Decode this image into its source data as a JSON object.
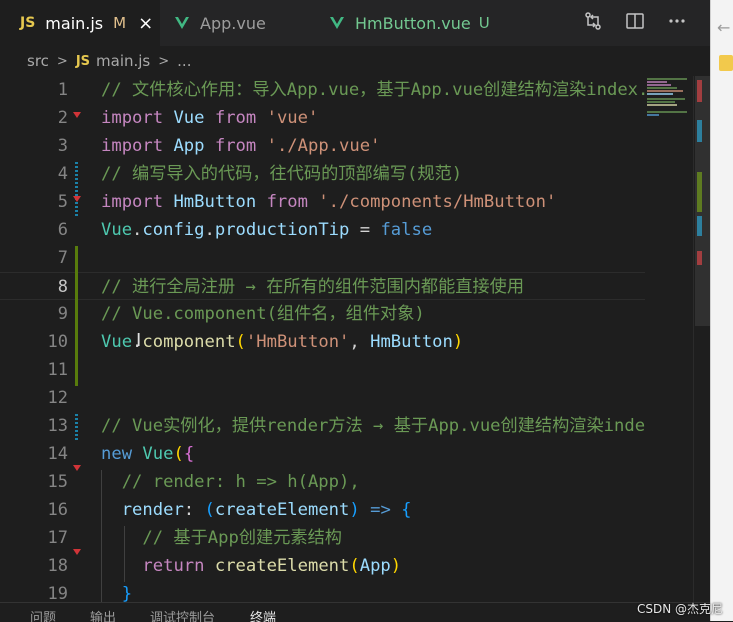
{
  "tabs": [
    {
      "badge": "JS",
      "label": "main.js",
      "status": "M",
      "close": "×"
    },
    {
      "label": "App.vue"
    },
    {
      "label": "HmButton.vue",
      "status": "U"
    }
  ],
  "breadcrumb": {
    "folder": "src",
    "file_badge": "JS",
    "file": "main.js",
    "more": "..."
  },
  "editor": {
    "line_numbers": [
      "1",
      "2",
      "3",
      "4",
      "5",
      "6",
      "7",
      "8",
      "9",
      "10",
      "11",
      "12",
      "13",
      "14",
      "15",
      "16",
      "17",
      "18",
      "19"
    ],
    "lines": [
      [
        {
          "t": "// 文件核心作用：导入App.vue，基于App.vue创建结构渲染index.html",
          "c": "com"
        }
      ],
      [
        {
          "t": "import ",
          "c": "ctl"
        },
        {
          "t": "Vue ",
          "c": "id"
        },
        {
          "t": "from ",
          "c": "ctl"
        },
        {
          "t": "'vue'",
          "c": "str"
        }
      ],
      [
        {
          "t": "import ",
          "c": "ctl"
        },
        {
          "t": "App ",
          "c": "id"
        },
        {
          "t": "from ",
          "c": "ctl"
        },
        {
          "t": "'./App.vue'",
          "c": "str"
        }
      ],
      [
        {
          "t": "// 编写导入的代码，往代码的顶部编写(规范)",
          "c": "com"
        }
      ],
      [
        {
          "t": "import ",
          "c": "ctl"
        },
        {
          "t": "HmButton ",
          "c": "id"
        },
        {
          "t": "from ",
          "c": "ctl"
        },
        {
          "t": "'./components/HmButton'",
          "c": "str"
        }
      ],
      [
        {
          "t": "Vue",
          "c": "cls"
        },
        {
          "t": ".",
          "c": "op"
        },
        {
          "t": "config",
          "c": "id"
        },
        {
          "t": ".",
          "c": "op"
        },
        {
          "t": "productionTip",
          "c": "id"
        },
        {
          "t": " = ",
          "c": "op"
        },
        {
          "t": "false",
          "c": "kw"
        }
      ],
      [],
      [
        {
          "t": "// 进行全局注册 → 在所有的组件范围内都能直接使用",
          "c": "com"
        }
      ],
      [
        {
          "t": "// Vue.component(组件名，组件对象)",
          "c": "com"
        }
      ],
      [
        {
          "t": "Vue",
          "c": "cls"
        },
        {
          "t": ".",
          "c": "op"
        },
        {
          "t": "component",
          "c": "fn"
        },
        {
          "t": "(",
          "c": "b1"
        },
        {
          "t": "'HmButton'",
          "c": "str"
        },
        {
          "t": ", ",
          "c": "op"
        },
        {
          "t": "HmButton",
          "c": "id"
        },
        {
          "t": ")",
          "c": "b1"
        }
      ],
      [],
      [],
      [
        {
          "t": "// Vue实例化，提供render方法 → 基于App.vue创建结构渲染index.html",
          "c": "com"
        }
      ],
      [
        {
          "t": "new ",
          "c": "kw"
        },
        {
          "t": "Vue",
          "c": "cls"
        },
        {
          "t": "(",
          "c": "b1"
        },
        {
          "t": "{",
          "c": "b2"
        }
      ],
      [
        {
          "t": "  // render: h => h(App),",
          "c": "com"
        }
      ],
      [
        {
          "t": "  ",
          "c": "op"
        },
        {
          "t": "render",
          "c": "id"
        },
        {
          "t": ": ",
          "c": "op"
        },
        {
          "t": "(",
          "c": "b3"
        },
        {
          "t": "createElement",
          "c": "id"
        },
        {
          "t": ")",
          "c": "b3"
        },
        {
          "t": " ",
          "c": "op"
        },
        {
          "t": "=>",
          "c": "kw"
        },
        {
          "t": " ",
          "c": "op"
        },
        {
          "t": "{",
          "c": "b3"
        }
      ],
      [
        {
          "t": "    // 基于App创建元素结构",
          "c": "com"
        }
      ],
      [
        {
          "t": "    ",
          "c": "op"
        },
        {
          "t": "return ",
          "c": "ctl"
        },
        {
          "t": "createElement",
          "c": "fn"
        },
        {
          "t": "(",
          "c": "b1"
        },
        {
          "t": "App",
          "c": "id"
        },
        {
          "t": ")",
          "c": "b1"
        }
      ],
      [
        {
          "t": "  ",
          "c": "op"
        },
        {
          "t": "}",
          "c": "b3"
        }
      ]
    ]
  },
  "panel": {
    "tabs": [
      "问题",
      "输出",
      "调试控制台",
      "终端"
    ]
  },
  "icons": {
    "compare": "compare-changes-icon",
    "split": "split-editor-icon",
    "more": "more-actions-icon"
  },
  "watermark": "CSDN @杰克尼",
  "colors": {
    "comment": "#6a9955",
    "keyword": "#569cd6",
    "control": "#c586c0",
    "string": "#ce9178",
    "class": "#4ec9b0",
    "function": "#dcdcaa",
    "variable": "#9cdcfe"
  }
}
